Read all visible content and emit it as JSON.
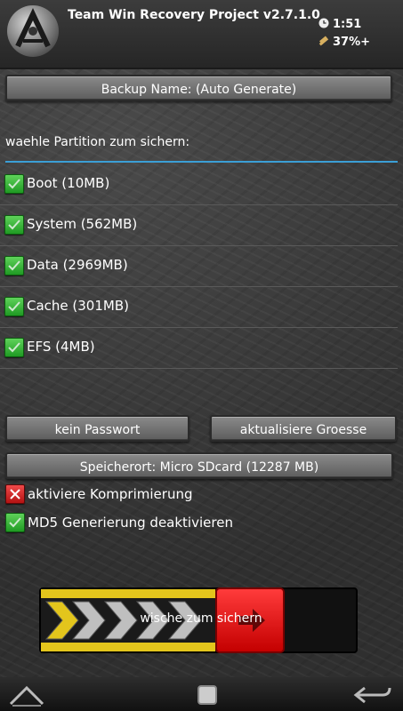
{
  "header": {
    "title": "Team Win Recovery Project  v2.7.1.0",
    "time": "1:51",
    "battery": "37%+",
    "logo_icon": "twrp-logo-icon",
    "clock_icon": "clock-icon",
    "battery_icon": "battery-icon"
  },
  "backup_name_button": "Backup Name: (Auto Generate)",
  "prompt": "waehle Partition zum sichern:",
  "partitions": [
    {
      "label": "Boot (10MB)",
      "checked": true
    },
    {
      "label": "System (562MB)",
      "checked": true
    },
    {
      "label": "Data (2969MB)",
      "checked": true
    },
    {
      "label": "Cache (301MB)",
      "checked": true
    },
    {
      "label": "EFS (4MB)",
      "checked": true
    }
  ],
  "buttons": {
    "password": "kein Passwort",
    "refresh_size": "aktualisiere Groesse",
    "storage": "Speicherort: Micro SDcard (12287 MB)"
  },
  "options": [
    {
      "label": "aktiviere Komprimierung",
      "checked": false
    },
    {
      "label": "MD5 Generierung deaktivieren",
      "checked": true
    }
  ],
  "slider": {
    "label": "wische zum sichern"
  },
  "colors": {
    "accent": "#3b9fd6",
    "checkbox_on": "#2fb52f",
    "checkbox_off": "#d81f1f",
    "slider_track": "#e3c51c",
    "slider_handle": "#e01010"
  },
  "nav": {
    "home_icon": "home-icon",
    "recents_icon": "square-icon",
    "back_icon": "back-arrow-icon"
  }
}
